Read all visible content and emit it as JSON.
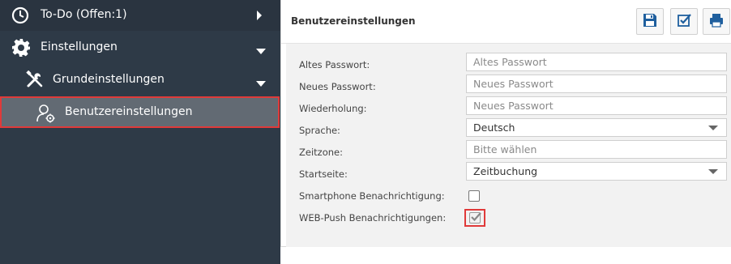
{
  "sidebar": {
    "items": [
      {
        "label": "To-Do (Offen:1)",
        "icon": "clock-icon",
        "arrow": "chevron-right-icon"
      },
      {
        "label": "Einstellungen",
        "icon": "gear-icon",
        "arrow": "caret-down-icon"
      },
      {
        "label": "Grundeinstellungen",
        "icon": "wrench-screwdriver-icon",
        "arrow": "caret-down-icon"
      },
      {
        "label": "Benutzereinstellungen",
        "icon": "user-settings-icon",
        "selected": true
      }
    ]
  },
  "panel": {
    "title": "Benutzereinstellungen",
    "toolbar": {
      "save_icon": "save-icon",
      "check_icon": "checkbox-check-icon",
      "print_icon": "print-icon"
    }
  },
  "form": {
    "old_password": {
      "label": "Altes Passwort:",
      "placeholder": "Altes Passwort",
      "value": ""
    },
    "new_password": {
      "label": "Neues Passwort:",
      "placeholder": "Neues Passwort",
      "value": ""
    },
    "repeat": {
      "label": "Wiederholung:",
      "placeholder": "Neues Passwort",
      "value": ""
    },
    "language": {
      "label": "Sprache:",
      "value": "Deutsch"
    },
    "timezone": {
      "label": "Zeitzone:",
      "placeholder": "Bitte wählen",
      "value": ""
    },
    "startpage": {
      "label": "Startseite:",
      "value": "Zeitbuchung"
    },
    "smartphone_notify": {
      "label": "Smartphone Benachrichtigung:",
      "checked": false
    },
    "webpush_notify": {
      "label": "WEB-Push Benachrichtigungen:",
      "checked": true
    }
  },
  "colors": {
    "sidebar_bg": "#2e3a47",
    "selected_bg": "#626a73",
    "highlight_border": "#e03a3a",
    "accent_blue": "#1f5f9e"
  }
}
